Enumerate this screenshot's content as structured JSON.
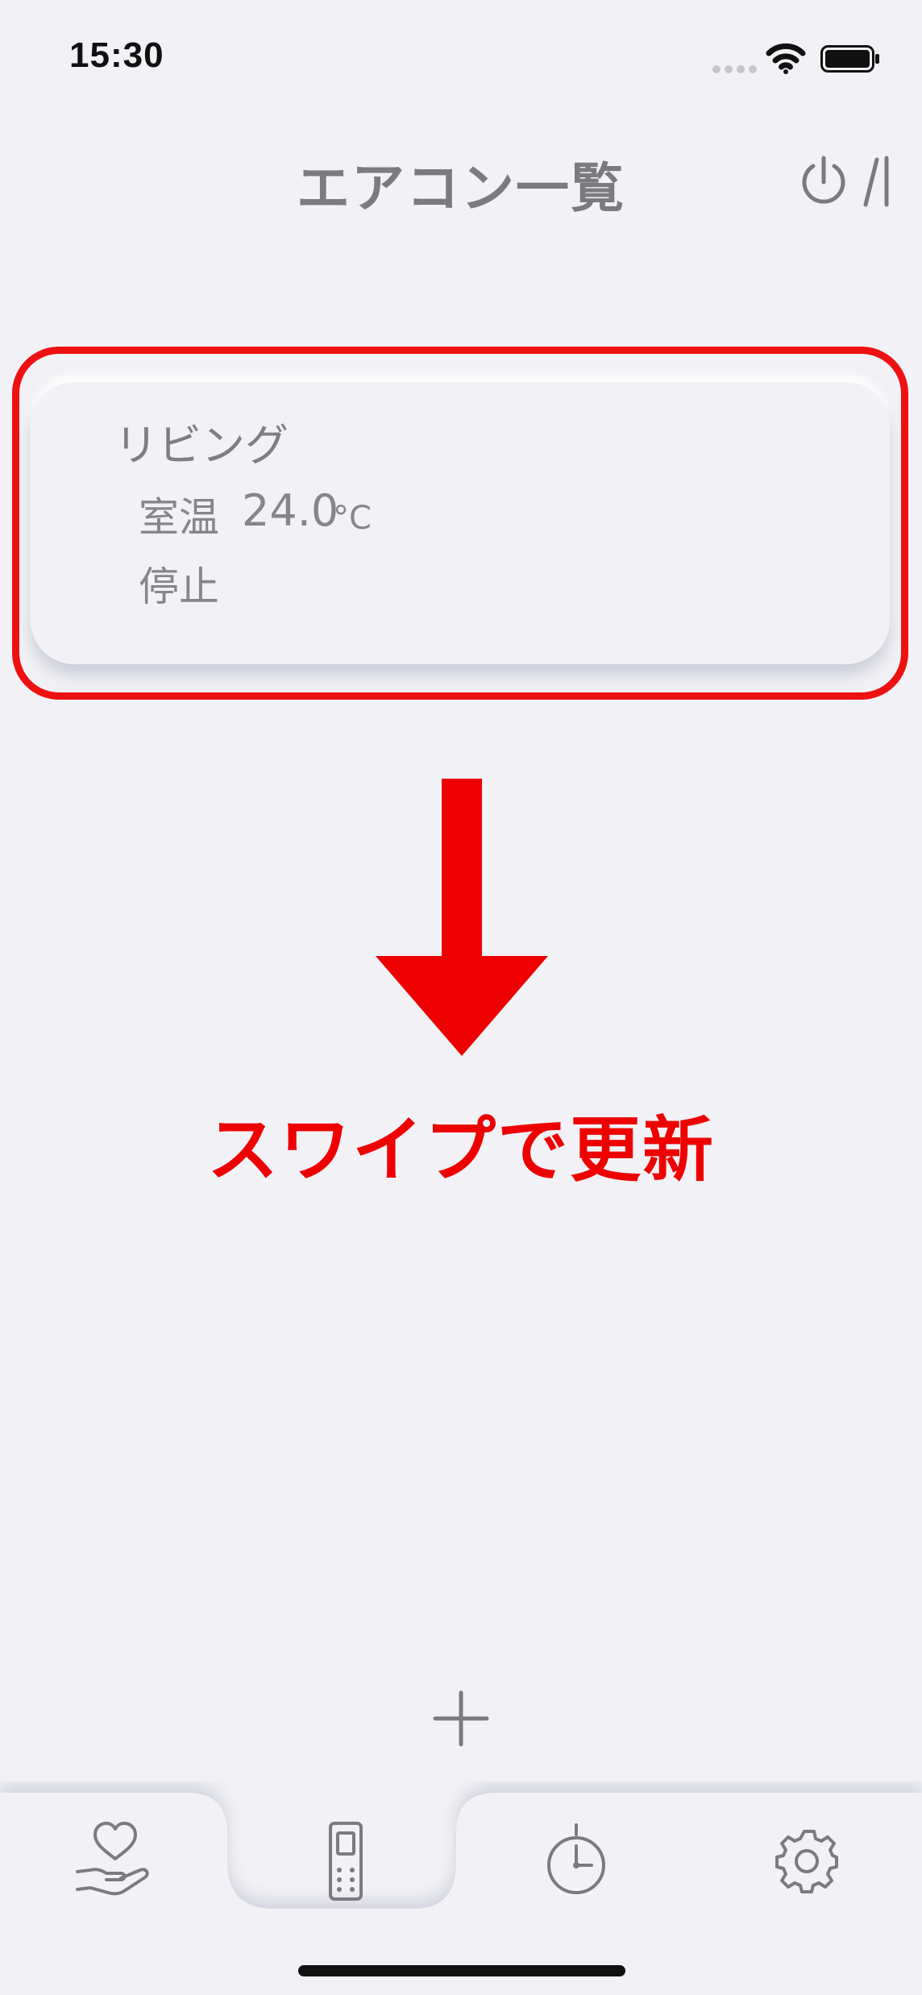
{
  "status_bar": {
    "time": "15:30"
  },
  "header": {
    "title": "エアコン一覧",
    "power_icon": "power-toggle-icon"
  },
  "devices": [
    {
      "name": "リビング",
      "temp_label": "室温",
      "temp_value": "24.0",
      "temp_unit": "°C",
      "status": "停止"
    }
  ],
  "annotation": {
    "text": "スワイプで更新",
    "color": "#ee0000"
  },
  "tabs": [
    {
      "icon": "heart-hand-icon",
      "selected": false
    },
    {
      "icon": "remote-control-icon",
      "selected": true
    },
    {
      "icon": "timer-icon",
      "selected": false
    },
    {
      "icon": "gear-icon",
      "selected": false
    }
  ],
  "colors": {
    "background": "#f2f2f6",
    "text": "#7d7d83",
    "highlight": "#ee1111"
  }
}
